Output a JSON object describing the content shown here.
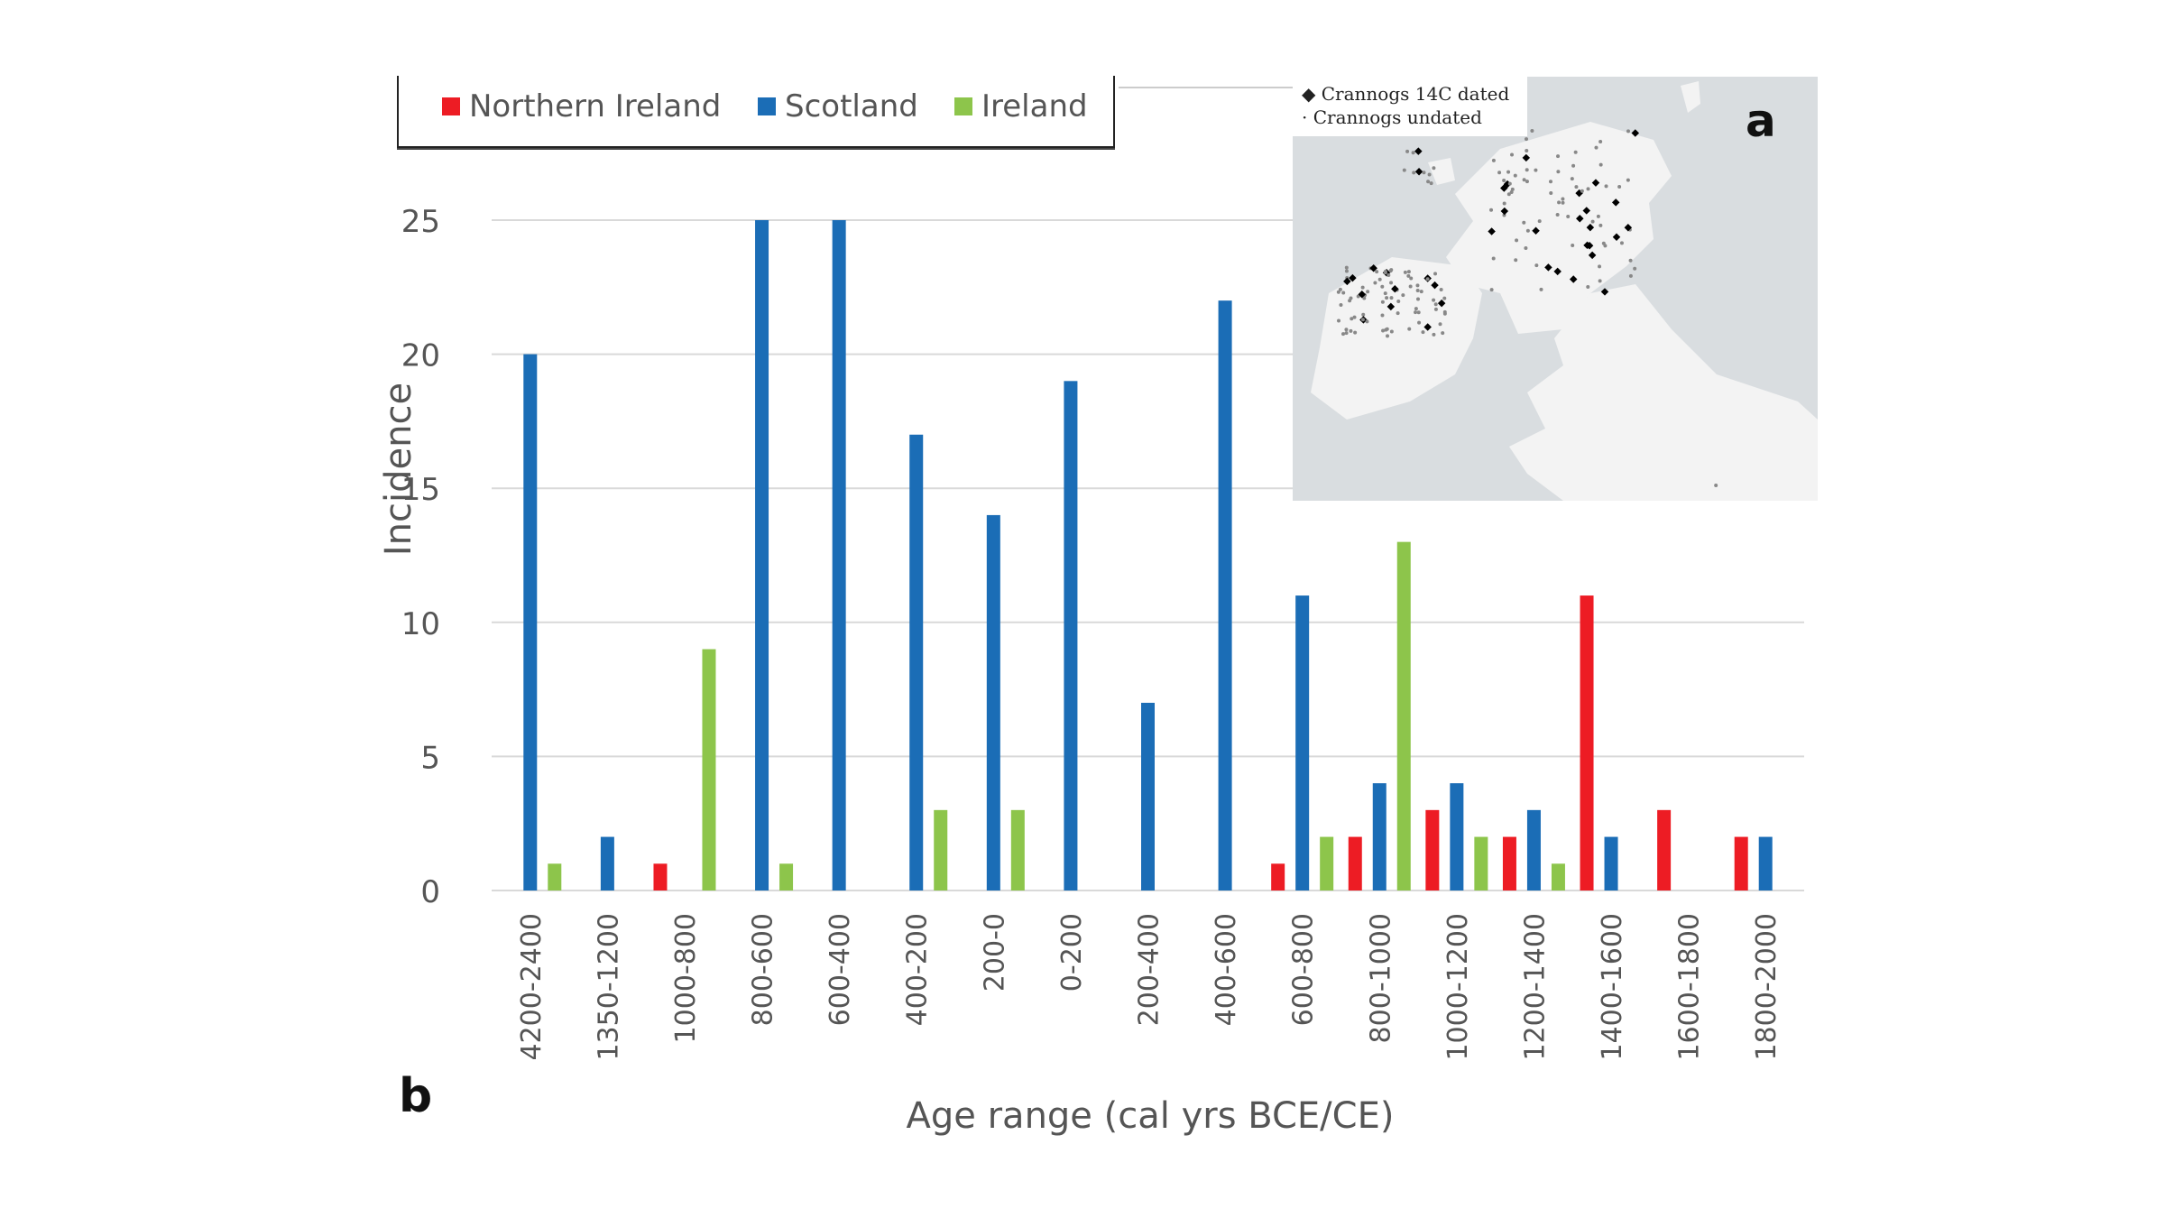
{
  "chart_data": {
    "type": "bar",
    "title": "",
    "xlabel": "Age range (cal yrs BCE/CE)",
    "ylabel": "Incidence",
    "ylim": [
      0,
      25
    ],
    "yticks": [
      0,
      5,
      10,
      15,
      20,
      25
    ],
    "grid": true,
    "legend_placement": "top-left",
    "categories": [
      "4200-2400",
      "1350-1200",
      "1000-800",
      "800-600",
      "600-400",
      "400-200",
      "200-0",
      "0-200",
      "200-400",
      "400-600",
      "600-800",
      "800-1000",
      "1000-1200",
      "1200-1400",
      "1400-1600",
      "1600-1800",
      "1800-2000"
    ],
    "series": [
      {
        "name": "Northern Ireland",
        "color": "#ed1c24",
        "values": [
          0,
          0,
          1,
          0,
          0,
          0,
          0,
          0,
          0,
          0,
          1,
          2,
          3,
          2,
          11,
          3,
          2
        ]
      },
      {
        "name": "Scotland",
        "color": "#1b6db6",
        "values": [
          20,
          2,
          0,
          25,
          25,
          17,
          14,
          19,
          7,
          22,
          11,
          4,
          4,
          3,
          2,
          0,
          2
        ]
      },
      {
        "name": "Ireland",
        "color": "#8dc54b",
        "values": [
          1,
          0,
          9,
          1,
          0,
          3,
          3,
          0,
          0,
          0,
          2,
          13,
          2,
          1,
          0,
          0,
          0
        ]
      }
    ]
  },
  "inset_map": {
    "legend": [
      {
        "symbol": "diamond",
        "label": "Crannogs 14C dated"
      },
      {
        "symbol": "dot",
        "label": "Crannogs undated"
      }
    ]
  },
  "panel_labels": {
    "a": "a",
    "b": "b"
  }
}
